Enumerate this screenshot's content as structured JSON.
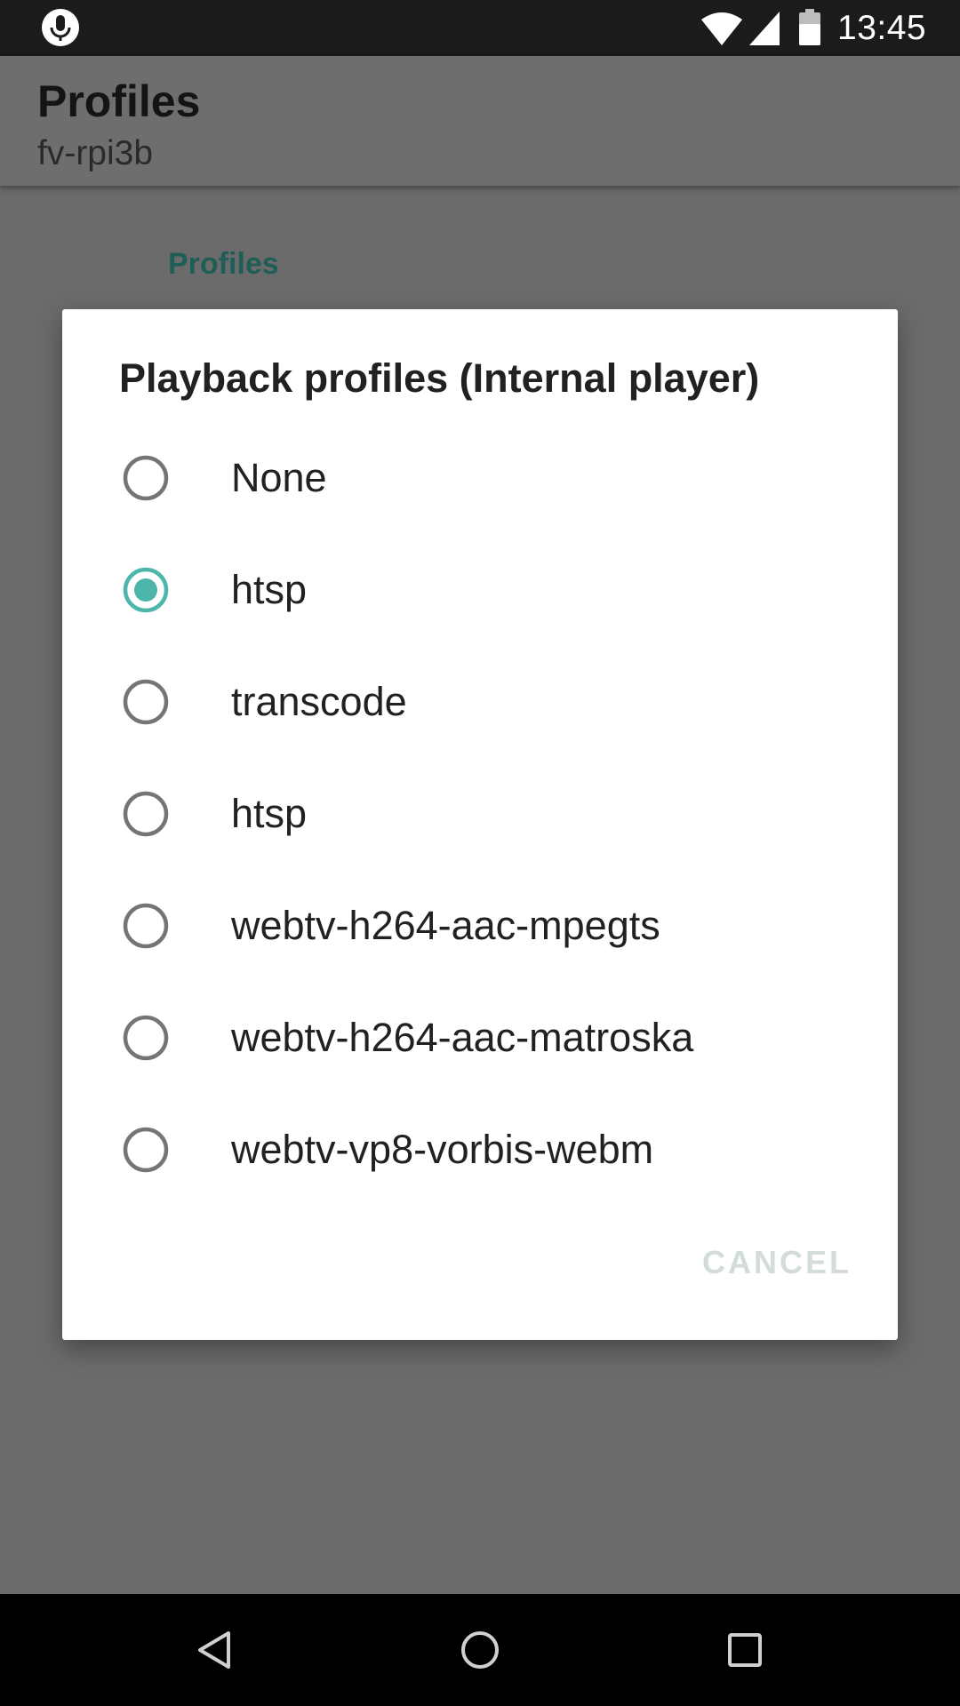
{
  "status_bar": {
    "time": "13:45",
    "icons": [
      "mic-icon",
      "wifi-icon",
      "signal-icon",
      "battery-icon"
    ]
  },
  "app_bar": {
    "title": "Profiles",
    "subtitle": "fv-rpi3b"
  },
  "background": {
    "section_header": "Profiles"
  },
  "dialog": {
    "title": "Playback profiles (Internal player)",
    "selected_index": 1,
    "options": [
      {
        "label": "None"
      },
      {
        "label": "htsp"
      },
      {
        "label": "transcode"
      },
      {
        "label": "htsp"
      },
      {
        "label": "webtv-h264-aac-mpegts"
      },
      {
        "label": "webtv-h264-aac-matroska"
      },
      {
        "label": "webtv-vp8-vorbis-webm"
      }
    ],
    "cancel_label": "CANCEL"
  },
  "nav_bar": {
    "icons": [
      "back-icon",
      "home-icon",
      "recents-icon"
    ]
  },
  "colors": {
    "accent": "#4db6ac",
    "scrim": "#6b6b6b",
    "radio_unchecked": "#757575",
    "cancel_text": "#d4dcdb"
  }
}
